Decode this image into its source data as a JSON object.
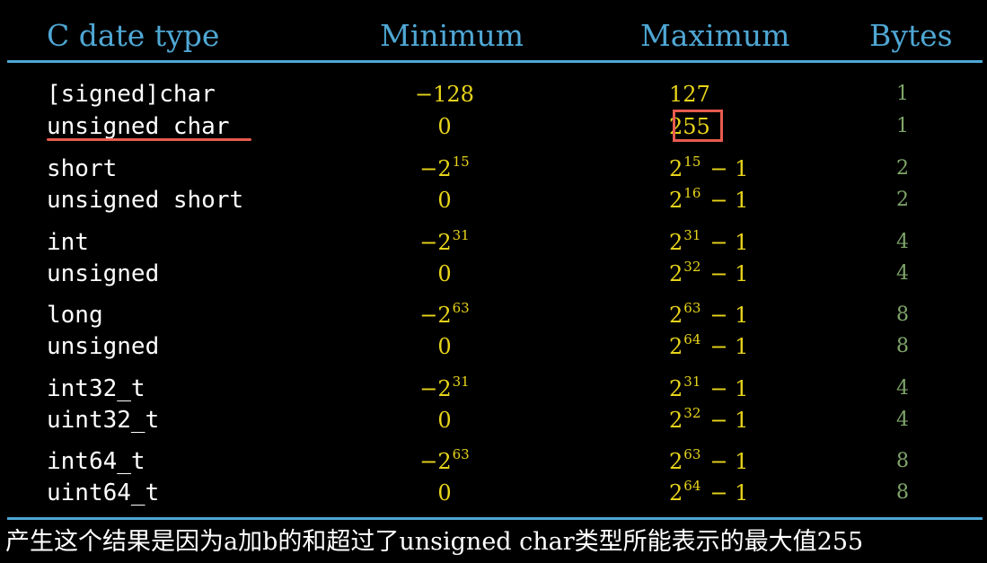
{
  "colors": {
    "header": "#4fa7d4",
    "rule": "#4fa7d4",
    "type_text": "#ffffff",
    "min_max": "#e8d41a",
    "bytes": "#7fa66a",
    "highlight": "#e85a4f",
    "caption": "#ffffff"
  },
  "header": {
    "type": "C date type",
    "min": "Minimum",
    "max": "Maximum",
    "bytes": "Bytes"
  },
  "rows": [
    {
      "type": "[signed]char",
      "min_base": "−128",
      "min_exp": "",
      "max_base": "127",
      "max_exp": "",
      "max_minus": "",
      "bytes": "1"
    },
    {
      "type": "unsigned char",
      "min_base": "0",
      "min_exp": "",
      "max_base": "255",
      "max_exp": "",
      "max_minus": "",
      "bytes": "1"
    },
    {
      "type": "short",
      "min_base": "−2",
      "min_exp": "15",
      "max_base": "2",
      "max_exp": "15",
      "max_minus": "− 1",
      "bytes": "2"
    },
    {
      "type": "unsigned short",
      "min_base": "0",
      "min_exp": "",
      "max_base": "2",
      "max_exp": "16",
      "max_minus": "− 1",
      "bytes": "2"
    },
    {
      "type": "int",
      "min_base": "−2",
      "min_exp": "31",
      "max_base": "2",
      "max_exp": "31",
      "max_minus": "− 1",
      "bytes": "4"
    },
    {
      "type": "unsigned",
      "min_base": "0",
      "min_exp": "",
      "max_base": "2",
      "max_exp": "32",
      "max_minus": "− 1",
      "bytes": "4"
    },
    {
      "type": "long",
      "min_base": "−2",
      "min_exp": "63",
      "max_base": "2",
      "max_exp": "63",
      "max_minus": "− 1",
      "bytes": "8"
    },
    {
      "type": "unsigned",
      "min_base": "0",
      "min_exp": "",
      "max_base": "2",
      "max_exp": "64",
      "max_minus": "− 1",
      "bytes": "8"
    },
    {
      "type": "int32_t",
      "min_base": "−2",
      "min_exp": "31",
      "max_base": "2",
      "max_exp": "31",
      "max_minus": "− 1",
      "bytes": "4"
    },
    {
      "type": "uint32_t",
      "min_base": "0",
      "min_exp": "",
      "max_base": "2",
      "max_exp": "32",
      "max_minus": "− 1",
      "bytes": "4"
    },
    {
      "type": "int64_t",
      "min_base": "−2",
      "min_exp": "63",
      "max_base": "2",
      "max_exp": "63",
      "max_minus": "− 1",
      "bytes": "8"
    },
    {
      "type": "uint64_t",
      "min_base": "0",
      "min_exp": "",
      "max_base": "2",
      "max_exp": "64",
      "max_minus": "− 1",
      "bytes": "8"
    }
  ],
  "caption": "产生这个结果是因为a加b的和超过了unsigned char类型所能表示的最大值255"
}
